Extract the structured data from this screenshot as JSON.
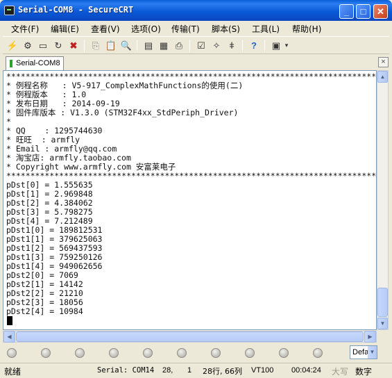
{
  "window": {
    "title": "Serial-COM8 - SecureCRT"
  },
  "menu": [
    "文件(F)",
    "编辑(E)",
    "查看(V)",
    "选项(O)",
    "传输(T)",
    "脚本(S)",
    "工具(L)",
    "帮助(H)"
  ],
  "toolbar_icons": [
    "connect-icon",
    "quick-connect-icon",
    "connect-in-tab-icon",
    "reconnect-icon",
    "disconnect-icon",
    "copy-icon",
    "paste-icon",
    "find-icon",
    "print-setup-icon",
    "print-selection-icon",
    "print-icon",
    "session-options-icon",
    "global-options-icon",
    "keymap-icon",
    "help-icon",
    "sftp-icon"
  ],
  "tab": {
    "label": "Serial-COM8",
    "close": "×"
  },
  "terminal": {
    "lines": [
      "********************************************************************************",
      "* 例程名称   : V5-917_ComplexMathFunctions的使用(二)",
      "* 例程版本   : 1.0",
      "* 发布日期   : 2014-09-19",
      "* 固件库版本 : V1.3.0 (STM32F4xx_StdPeriph_Driver)",
      "*",
      "* QQ    : 1295744630",
      "* 旺旺  : armfly",
      "* Email : armfly@qq.com",
      "* 淘宝店: armfly.taobao.com",
      "* Copyright www.armfly.com 安富莱电子",
      "********************************************************************************",
      "pDst[0] = 1.555635",
      "pDst[1] = 2.969848",
      "pDst[2] = 4.384062",
      "pDst[3] = 5.798275",
      "pDst[4] = 7.212489",
      "pDst1[0] = 189812531",
      "pDst1[1] = 379625063",
      "pDst1[2] = 569437593",
      "pDst1[3] = 759250126",
      "pDst1[4] = 949062656",
      "pDst2[0] = 7069",
      "pDst2[1] = 14142",
      "pDst2[2] = 21210",
      "pDst2[3] = 18056",
      "pDst2[4] = 10984"
    ]
  },
  "buttonbar": {
    "combo_value": "Defa"
  },
  "status": {
    "ready": "就绪",
    "session": "Serial: COM14",
    "row": "28,",
    "col": "1",
    "rows_cols": "28行, 66列",
    "emulation": "VT100",
    "time": "00:04:24",
    "caps": "大写",
    "num": "数字"
  }
}
